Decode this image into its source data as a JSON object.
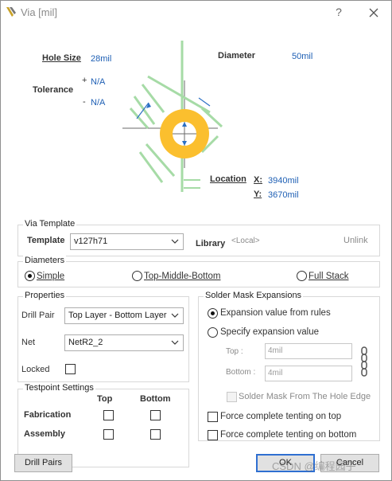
{
  "window": {
    "title": "Via [mil]",
    "help": "?"
  },
  "preview": {
    "hole_size_label": "Hole Size",
    "hole_size_value": "28mil",
    "tolerance_label": "Tolerance",
    "tol_plus_sign": "+",
    "tol_plus_value": "N/A",
    "tol_minus_sign": "-",
    "tol_minus_value": "N/A",
    "diameter_label": "Diameter",
    "diameter_value": "50mil",
    "location_label": "Location",
    "x_label": "X:",
    "x_value": "3940mil",
    "y_label": "Y:",
    "y_value": "3670mil",
    "colors": {
      "pad": "#fbbf2e",
      "guides": "#a6dba6",
      "hole": "#ffffff"
    }
  },
  "via_template": {
    "title": "Via Template",
    "template_label": "Template",
    "template_value": "v127h71",
    "library_label": "Library",
    "library_value": "<Local>",
    "unlink_label": "Unlink"
  },
  "diameters": {
    "title": "Diameters",
    "options": [
      "Simple",
      "Top-Middle-Bottom",
      "Full Stack"
    ],
    "selected": "Simple"
  },
  "properties": {
    "title": "Properties",
    "drill_pair_label": "Drill Pair",
    "drill_pair_value": "Top Layer - Bottom Layer",
    "net_label": "Net",
    "net_value": "NetR2_2",
    "locked_label": "Locked",
    "locked": false
  },
  "solder_mask": {
    "title": "Solder Mask Expansions",
    "opt_rules": "Expansion value from rules",
    "opt_specify": "Specify expansion value",
    "selected": "Expansion value from rules",
    "top_label": "Top :",
    "top_value": "4mil",
    "bottom_label": "Bottom :",
    "bottom_value": "4mil",
    "from_hole_edge_label": "Solder Mask From The Hole Edge",
    "tenting_top_label": "Force complete tenting on top",
    "tenting_bottom_label": "Force complete tenting on bottom"
  },
  "testpoint": {
    "title": "Testpoint Settings",
    "col_top": "Top",
    "col_bottom": "Bottom",
    "row_fabrication": "Fabrication",
    "row_assembly": "Assembly"
  },
  "buttons": {
    "drill_pairs": "Drill Pairs",
    "ok": "OK",
    "cancel": "Cancel"
  },
  "watermark": "CSDN @编程园子"
}
